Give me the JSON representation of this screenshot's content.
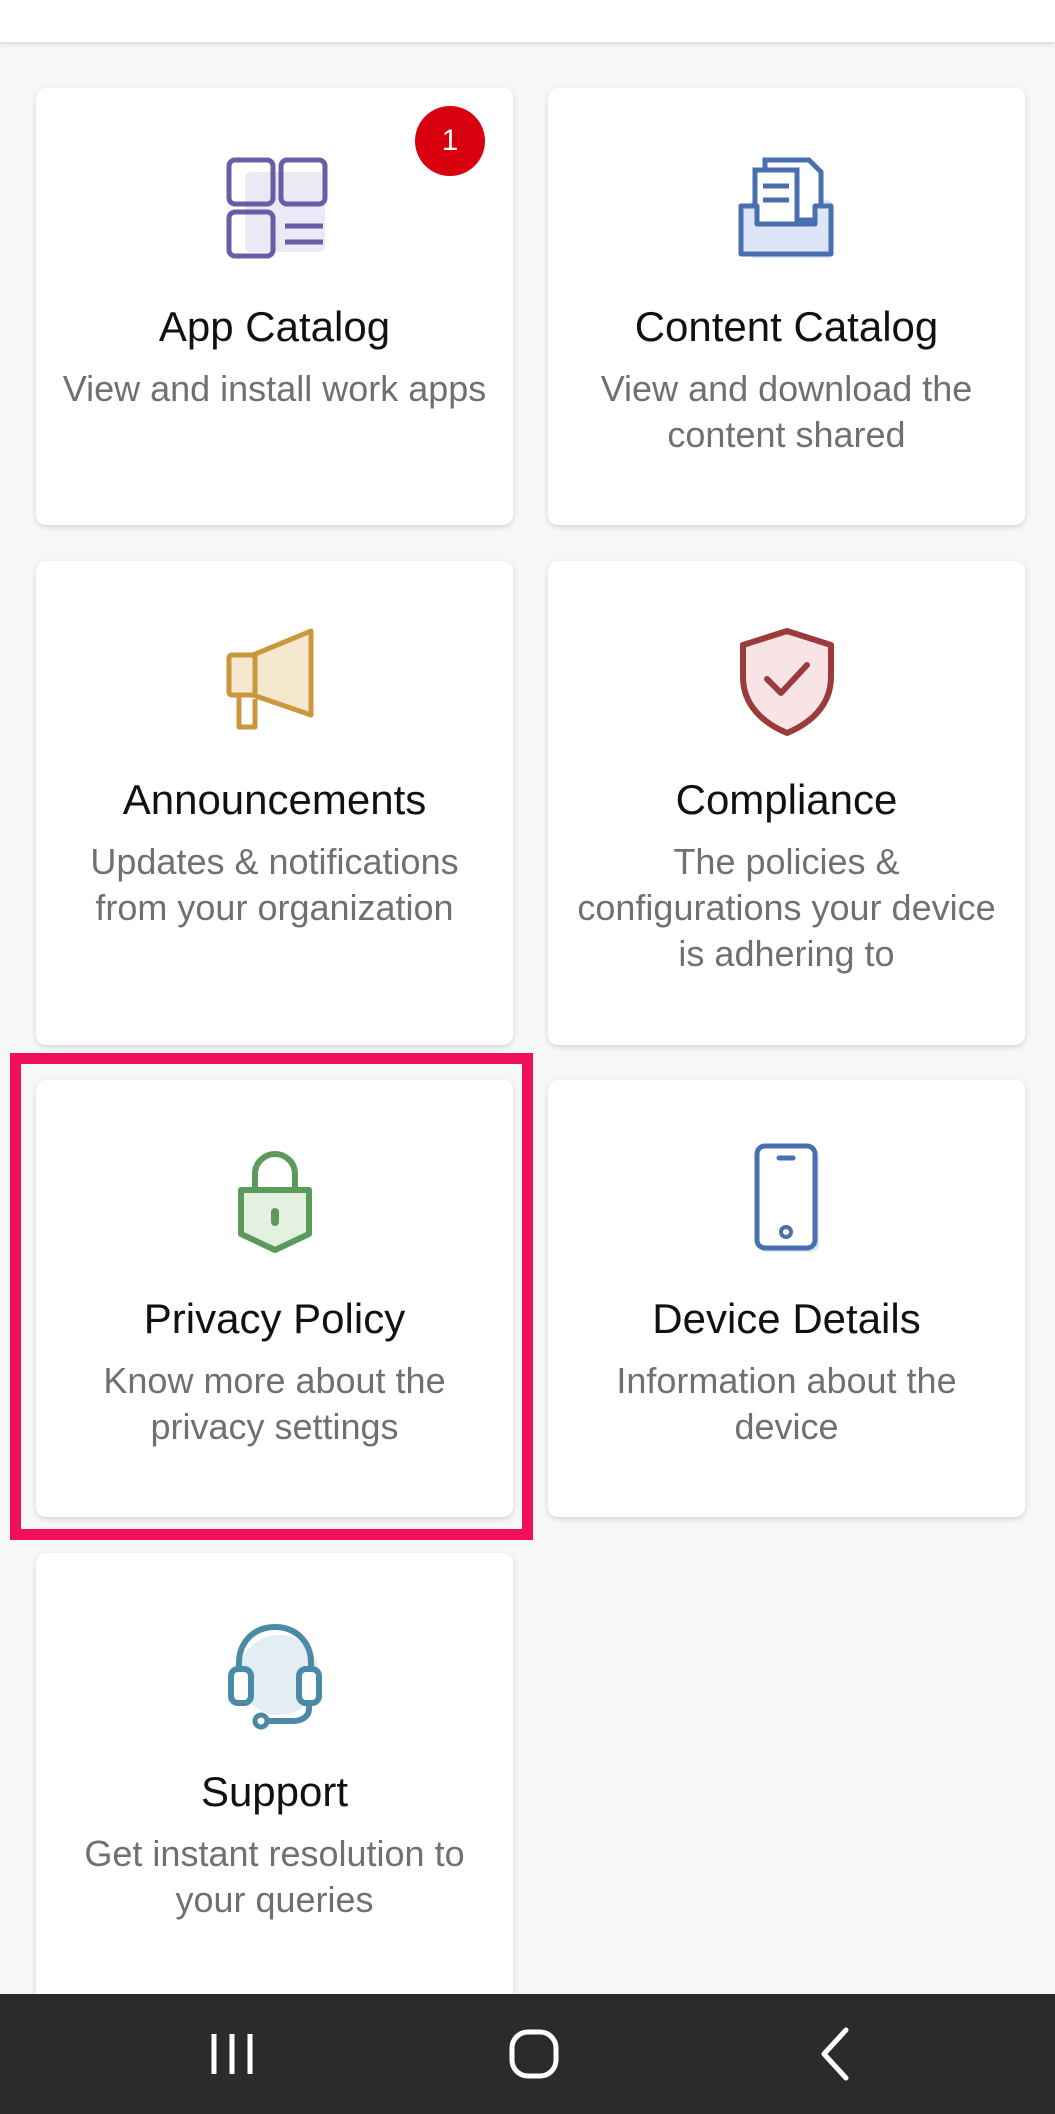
{
  "tiles": [
    {
      "title": "App Catalog",
      "desc": "View and install work apps",
      "icon": "app-grid-icon",
      "badge": "1"
    },
    {
      "title": "Content Catalog",
      "desc": "View and download the content shared",
      "icon": "document-tray-icon"
    },
    {
      "title": "Announcements",
      "desc": "Updates & notifications from your organization",
      "icon": "megaphone-icon"
    },
    {
      "title": "Compliance",
      "desc": "The policies & configurations your device is adhering to",
      "icon": "shield-check-icon"
    },
    {
      "title": "Privacy Policy",
      "desc": "Know more about the privacy settings",
      "icon": "lock-icon"
    },
    {
      "title": "Device Details",
      "desc": "Information about the device",
      "icon": "phone-icon"
    },
    {
      "title": "Support",
      "desc": "Get instant resolution to your queries",
      "icon": "headset-icon"
    }
  ],
  "nav": {
    "recents": "recent-apps-icon",
    "home": "home-icon",
    "back": "back-icon"
  },
  "colors": {
    "app_catalog": "#6b5ca8",
    "content_catalog": "#4a6fb0",
    "announcements": "#c9973c",
    "compliance": "#9b3b3b",
    "privacy": "#5b9a5b",
    "device": "#4a6fb0",
    "support": "#4b8aa6",
    "highlight": "#f0105a",
    "badge": "#d8000f"
  }
}
